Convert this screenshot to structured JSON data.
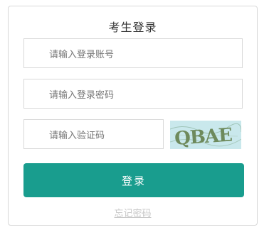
{
  "form": {
    "title": "考生登录",
    "account_placeholder": "请输入登录账号",
    "password_placeholder": "请输入登录密码",
    "captcha_placeholder": "请输入验证码",
    "captcha_text": "QBAE",
    "login_label": "登录",
    "forgot_label": "忘记密码"
  },
  "colors": {
    "accent": "#199d8e",
    "captcha_background": "#c9e8ec",
    "captcha_ink": "#6e8a5c"
  }
}
